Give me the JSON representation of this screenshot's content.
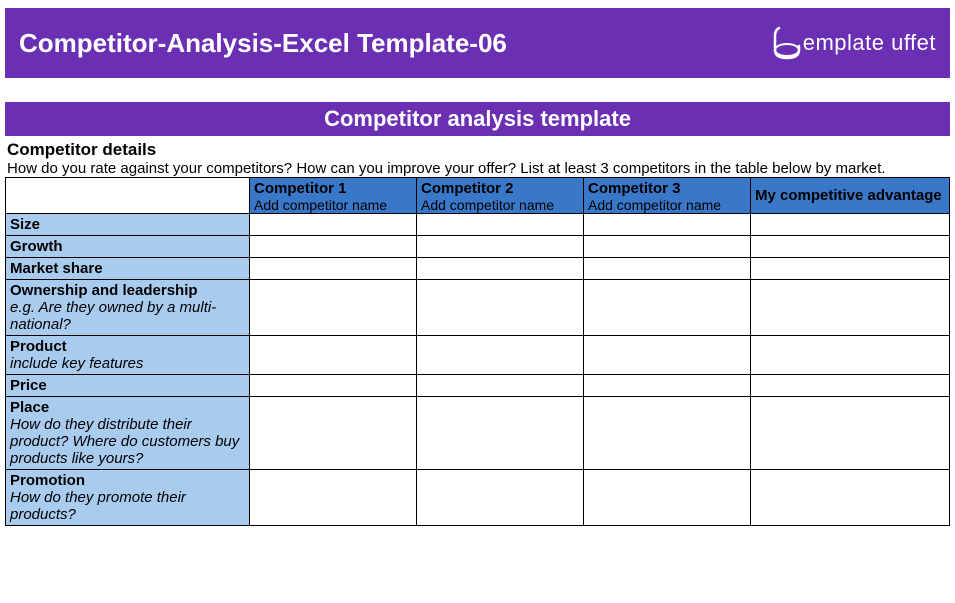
{
  "header": {
    "title": "Competitor-Analysis-Excel Template-06",
    "logo_text": "emplate uffet"
  },
  "subtitle": "Competitor analysis template",
  "section": {
    "title": "Competitor details",
    "description": "How do you rate against your competitors? How can you improve your offer? List at least 3 competitors in the table below by market."
  },
  "columns": {
    "comp1": {
      "title": "Competitor 1",
      "hint": "Add competitor name"
    },
    "comp2": {
      "title": "Competitor 2",
      "hint": "Add competitor name"
    },
    "comp3": {
      "title": "Competitor 3",
      "hint": "Add competitor name"
    },
    "advantage": "My competitive advantage"
  },
  "rows": [
    {
      "label": "Size",
      "sub": ""
    },
    {
      "label": "Growth",
      "sub": ""
    },
    {
      "label": "Market share",
      "sub": ""
    },
    {
      "label": "Ownership and leadership",
      "sub": "e.g. Are they owned by a multi-national?"
    },
    {
      "label": "Product",
      "sub": "include key features"
    },
    {
      "label": "Price",
      "sub": ""
    },
    {
      "label": "Place",
      "sub": "How do they distribute their product? Where do customers buy products like yours?"
    },
    {
      "label": "Promotion",
      "sub": "How do they promote their products?"
    }
  ]
}
